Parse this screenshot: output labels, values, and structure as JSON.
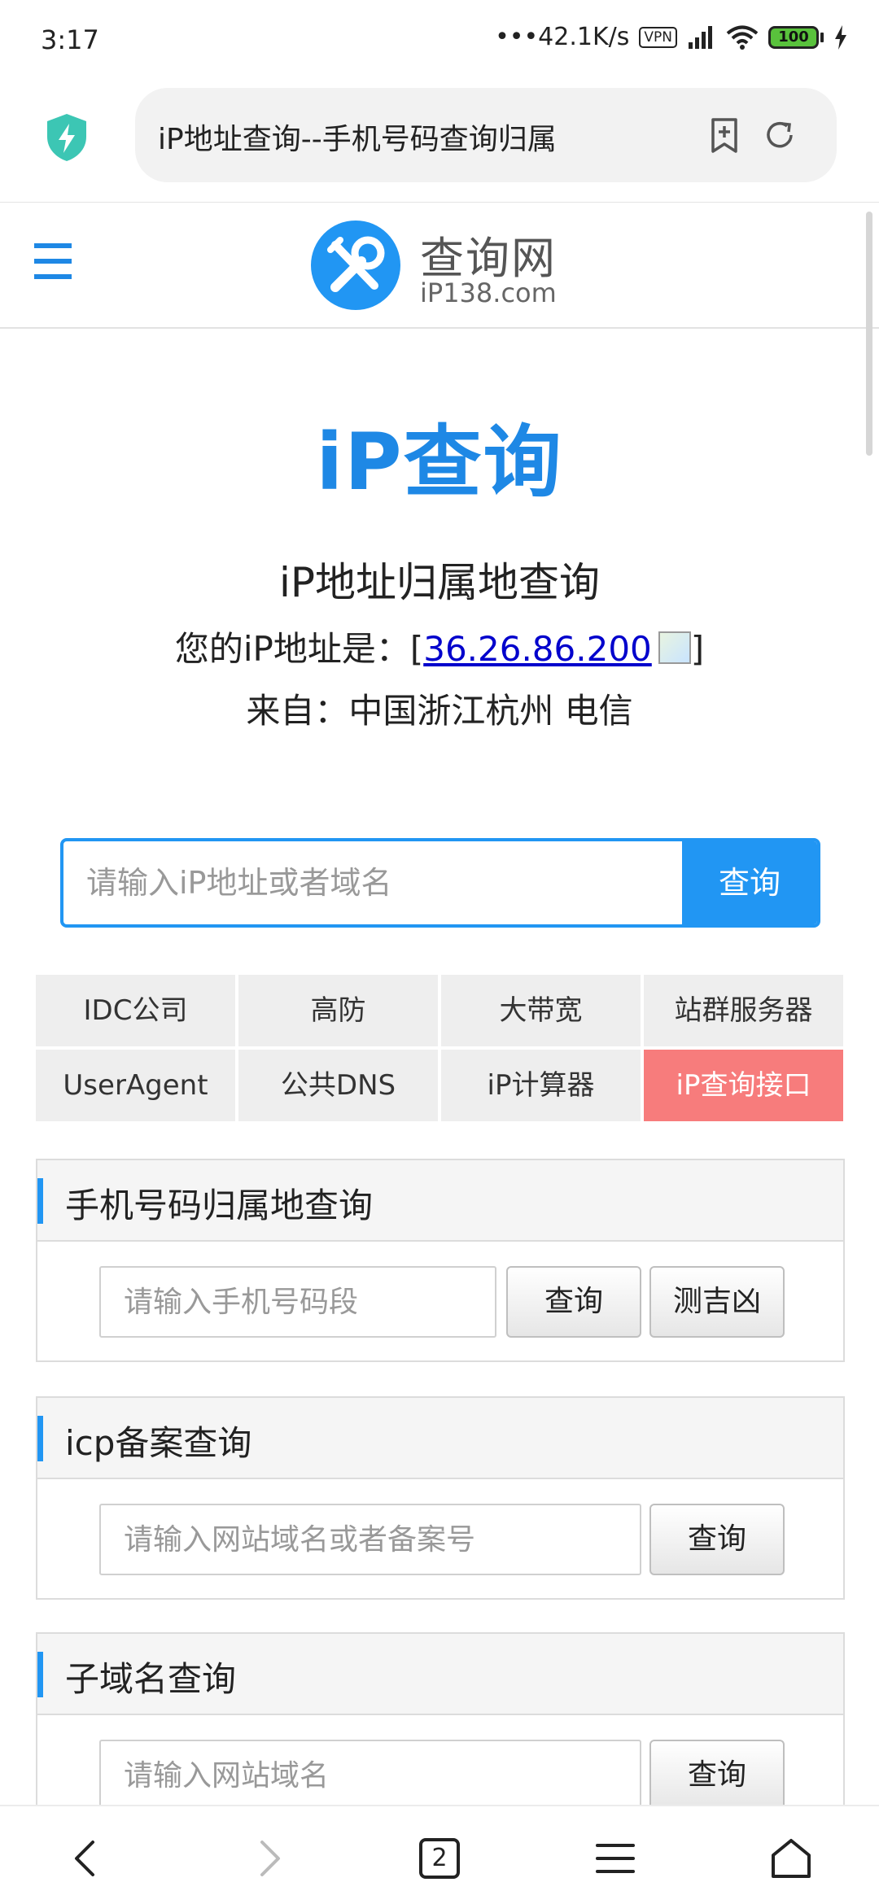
{
  "status_bar": {
    "time": "3:17",
    "speed": "•••42.1K/s",
    "vpn": "VPN",
    "battery": "100"
  },
  "browser": {
    "url_title": "iP地址查询--手机号码查询归属",
    "tab_count": "2"
  },
  "site": {
    "logo_title": "查询网",
    "logo_sub": "iP138.com"
  },
  "hero": {
    "title": "iP查询",
    "subtitle": "iP地址归属地查询",
    "ip_prefix": "您的iP地址是：[",
    "ip_address": "36.26.86.200",
    "ip_suffix": "]",
    "from": "来自：中国浙江杭州 电信"
  },
  "search": {
    "placeholder": "请输入iP地址或者域名",
    "button": "查询"
  },
  "quick_links": [
    {
      "label": "IDC公司"
    },
    {
      "label": "高防"
    },
    {
      "label": "大带宽"
    },
    {
      "label": "站群服务器"
    },
    {
      "label": "UserAgent"
    },
    {
      "label": "公共DNS"
    },
    {
      "label": "iP计算器"
    },
    {
      "label": "iP查询接口"
    }
  ],
  "panels": {
    "phone": {
      "title": "手机号码归属地查询",
      "placeholder": "请输入手机号码段",
      "button": "查询",
      "button2": "测吉凶"
    },
    "icp": {
      "title": "icp备案查询",
      "placeholder": "请输入网站域名或者备案号",
      "button": "查询"
    },
    "subdomain": {
      "title": "子域名查询",
      "placeholder": "请输入网站域名",
      "button": "查询"
    }
  },
  "colors": {
    "accent": "#2196f3",
    "hot_link": "#f77c7c",
    "link": "#0000cc"
  },
  "icons": {
    "shield": "shield-bolt-icon",
    "bookmark": "bookmark-add-icon",
    "refresh": "refresh-icon",
    "menu": "hamburger-icon",
    "back": "back-arrow-icon",
    "forward": "forward-arrow-icon",
    "tabs": "tabs-icon",
    "browser_menu": "menu-icon",
    "home": "home-icon"
  }
}
